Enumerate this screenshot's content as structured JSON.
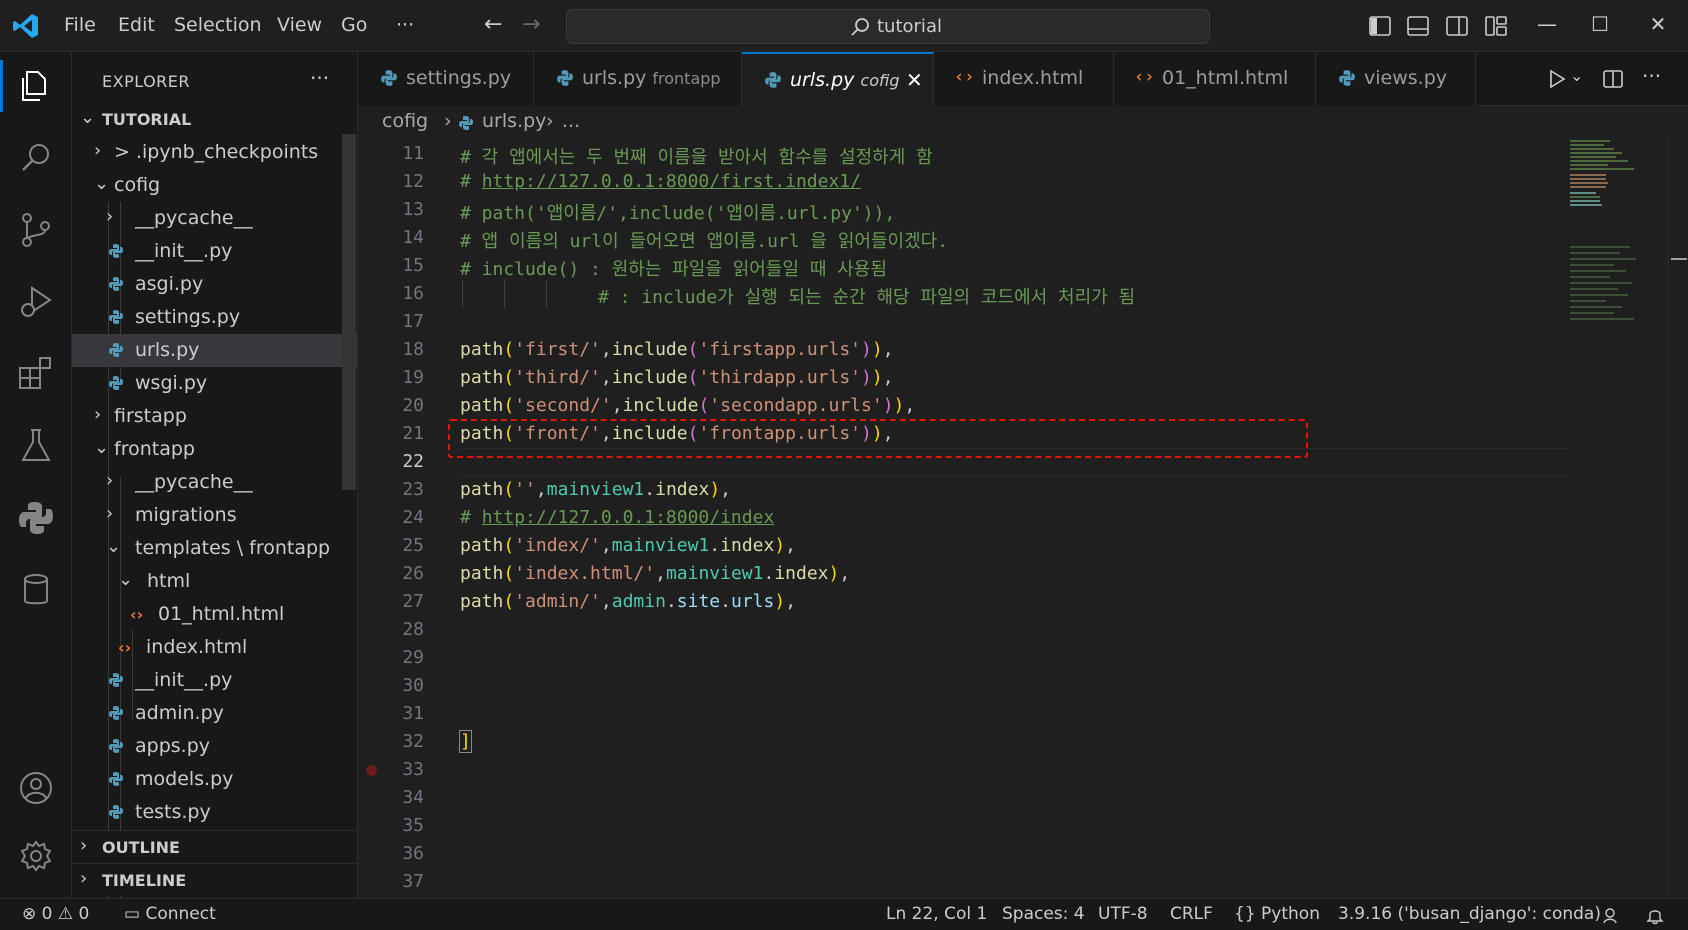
{
  "menu": {
    "file": "File",
    "edit": "Edit",
    "selection": "Selection",
    "view": "View",
    "go": "Go",
    "more": "···"
  },
  "command_center": {
    "text": "tutorial"
  },
  "sidebar": {
    "title": "EXPLORER",
    "more": "···",
    "root": "TUTORIAL",
    "items": [
      "> .ipynb_checkpoints",
      "cofig",
      "__pycache__",
      "__init__.py",
      "asgi.py",
      "settings.py",
      "urls.py",
      "wsgi.py",
      "firstapp",
      "frontapp",
      "__pycache__",
      "migrations",
      "templates \\ frontapp",
      "html",
      "01_html.html",
      "index.html",
      "__init__.py",
      "admin.py",
      "apps.py",
      "models.py",
      "tests.py"
    ],
    "outline": "OUTLINE",
    "timeline": "TIMELINE"
  },
  "tabs": [
    {
      "label": "settings.py",
      "desc": ""
    },
    {
      "label": "urls.py",
      "desc": "frontapp"
    },
    {
      "label": "urls.py",
      "desc": "cofig"
    },
    {
      "label": "index.html",
      "desc": ""
    },
    {
      "label": "01_html.html",
      "desc": ""
    },
    {
      "label": "views.py",
      "desc": ""
    }
  ],
  "breadcrumb": {
    "folder": "cofig",
    "file": "urls.py",
    "more": "..."
  },
  "editor": {
    "line_numbers": [
      "11",
      "12",
      "13",
      "14",
      "15",
      "16",
      "17",
      "18",
      "19",
      "20",
      "21",
      "22",
      "23",
      "24",
      "25",
      "26",
      "27",
      "28",
      "29",
      "30",
      "31",
      "32",
      "33",
      "34",
      "35",
      "36",
      "37"
    ],
    "comments": {
      "l11": "# 각 앱에서는 두 번째 이름을 받아서 함수를 설정하게 함",
      "l12_hash": "# ",
      "l12_url": "http://127.0.0.1:8000/first.index1/",
      "l13": "# path('앱이름/',include('앱이름.url.py')),",
      "l14": "# 앱 이름의 url이 들어오면 앱이름.url 을 읽어들이겠다.",
      "l15": "# include() : 원하는 파일을 읽어들일 때 사용됨",
      "l16": "# : include가 실행 되는 순간 해당 파일의 코드에서 처리가 됨",
      "l24_hash": "# ",
      "l24_url": "http://127.0.0.1:8000/index"
    },
    "code": {
      "path": "path",
      "include": "include",
      "s_first": "'first/'",
      "s_firstapp": "'firstapp.urls'",
      "s_third": "'third/'",
      "s_thirdapp": "'thirdapp.urls'",
      "s_second": "'second/'",
      "s_secondapp": "'secondapp.urls'",
      "s_front": "'front/'",
      "s_frontapp": "'frontapp.urls'",
      "s_empty": "''",
      "s_index": "'index/'",
      "s_indexhtml": "'index.html/'",
      "s_admin": "'admin/'",
      "mainview1": "mainview1",
      "index": "index",
      "admin": "admin",
      "site": "site",
      "urls": "urls",
      "open1": "(",
      "open2": "(",
      "close2": ")",
      "close1": ")",
      "comma": ",",
      "dot": ".",
      "bracket": "]"
    }
  },
  "statusbar": {
    "errors": "0",
    "warnings": "0",
    "connect": "Connect",
    "position": "Ln 22, Col 1",
    "spaces": "Spaces: 4",
    "encoding": "UTF-8",
    "eol": "CRLF",
    "language": "Python",
    "interpreter": "3.9.16 ('busan_django': conda)"
  },
  "colors": {
    "accent": "#0078d4",
    "python_icon": "#519aba",
    "html_icon": "#e37933",
    "highlight_box": "#e51400"
  }
}
